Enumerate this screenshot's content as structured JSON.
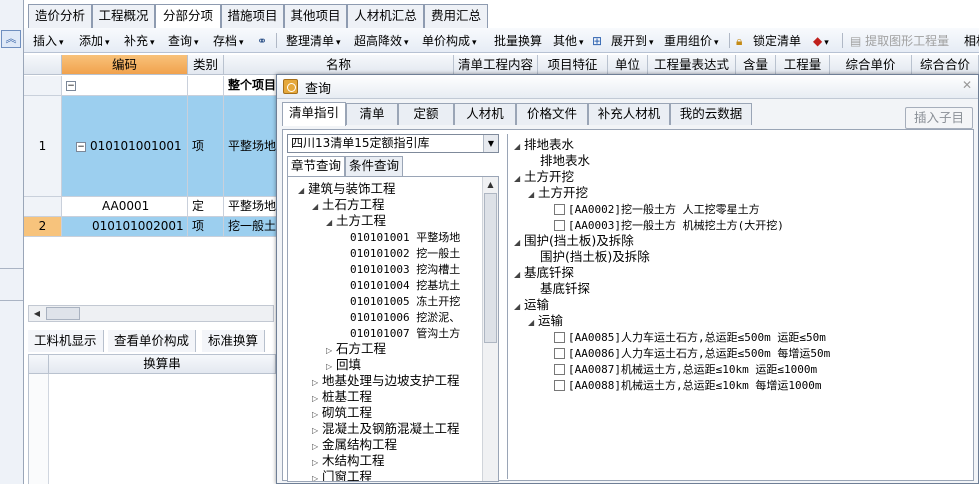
{
  "top_tabs": [
    "造价分析",
    "工程概况",
    "分部分项",
    "措施项目",
    "其他项目",
    "人材机汇总",
    "费用汇总"
  ],
  "active_top_tab": "分部分项",
  "toolbar": {
    "insert": "插入",
    "add": "添加",
    "supplement": "补充",
    "query": "查询",
    "archive": "存档",
    "organize": "整理清单",
    "super_reduce": "超高降效",
    "unit_composition": "单价构成",
    "batch_convert": "批量换算",
    "other": "其他",
    "expand_to": "展开到",
    "reuse_price": "重用组价",
    "lock_list": "锁定清单",
    "extract_quantity": "提取图形工程量",
    "related": "相相"
  },
  "grid": {
    "headers": [
      "编码",
      "类别",
      "名称",
      "清单工程内容",
      "项目特征",
      "单位",
      "工程量表达式",
      "含量",
      "工程量",
      "综合单价",
      "综合合价"
    ],
    "rows": [
      {
        "num": "",
        "code": "",
        "type": "",
        "name": "整个项目"
      },
      {
        "num": "1",
        "code": "010101001001",
        "type": "项",
        "name": "平整场地"
      },
      {
        "num": "",
        "code": "AA0001",
        "type": "定",
        "name": "平整场地"
      },
      {
        "num": "2",
        "code": "010101002001",
        "type": "项",
        "name": "挖一般土"
      }
    ]
  },
  "bottom_tabs": [
    "工料机显示",
    "查看单价构成",
    "标准换算"
  ],
  "bottom_header": "换算串",
  "dialog": {
    "title": "查询",
    "tabs": [
      "清单指引",
      "清单",
      "定额",
      "人材机",
      "价格文件",
      "补充人材机",
      "我的云数据"
    ],
    "active_tab": "清单指引",
    "insert_child": "插入子目",
    "library": "四川13清单15定额指引库",
    "left_tabs": [
      "章节查询",
      "条件查询"
    ],
    "left_tree": [
      {
        "text": "建筑与装饰工程",
        "level": 0,
        "state": "open"
      },
      {
        "text": "土石方工程",
        "level": 1,
        "state": "open"
      },
      {
        "text": "土方工程",
        "level": 2,
        "state": "open"
      },
      {
        "text": "010101001  平整场地",
        "level": 3,
        "state": "leaf"
      },
      {
        "text": "010101002  挖一般土",
        "level": 3,
        "state": "leaf"
      },
      {
        "text": "010101003  挖沟槽土",
        "level": 3,
        "state": "leaf"
      },
      {
        "text": "010101004  挖基坑土",
        "level": 3,
        "state": "leaf"
      },
      {
        "text": "010101005  冻土开挖",
        "level": 3,
        "state": "leaf"
      },
      {
        "text": "010101006  挖淤泥、",
        "level": 3,
        "state": "leaf"
      },
      {
        "text": "010101007  管沟土方",
        "level": 3,
        "state": "leaf"
      },
      {
        "text": "石方工程",
        "level": 2,
        "state": "closed"
      },
      {
        "text": "回填",
        "level": 2,
        "state": "closed"
      },
      {
        "text": "地基处理与边坡支护工程",
        "level": 1,
        "state": "closed"
      },
      {
        "text": "桩基工程",
        "level": 1,
        "state": "closed"
      },
      {
        "text": "砌筑工程",
        "level": 1,
        "state": "closed"
      },
      {
        "text": "混凝土及钢筋混凝土工程",
        "level": 1,
        "state": "closed"
      },
      {
        "text": "金属结构工程",
        "level": 1,
        "state": "closed"
      },
      {
        "text": "木结构工程",
        "level": 1,
        "state": "closed"
      },
      {
        "text": "门窗工程",
        "level": 1,
        "state": "closed"
      }
    ],
    "right_tree": [
      {
        "text": "排地表水",
        "level": 0,
        "state": "open"
      },
      {
        "text": "排地表水",
        "level": 1,
        "state": "leaf"
      },
      {
        "text": "土方开挖",
        "level": 0,
        "state": "open"
      },
      {
        "text": "土方开挖",
        "level": 1,
        "state": "open"
      },
      {
        "text": "[AA0002]挖一般土方 人工挖零星土方",
        "level": 2,
        "state": "check"
      },
      {
        "text": "[AA0003]挖一般土方 机械挖土方(大开挖)",
        "level": 2,
        "state": "check"
      },
      {
        "text": "围护(挡土板)及拆除",
        "level": 0,
        "state": "open"
      },
      {
        "text": "围护(挡土板)及拆除",
        "level": 1,
        "state": "leaf"
      },
      {
        "text": "基底钎探",
        "level": 0,
        "state": "open"
      },
      {
        "text": "基底钎探",
        "level": 1,
        "state": "leaf"
      },
      {
        "text": "运输",
        "level": 0,
        "state": "open"
      },
      {
        "text": "运输",
        "level": 1,
        "state": "open"
      },
      {
        "text": "[AA0085]人力车运土石方,总运距≤500m 运距≤50m",
        "level": 2,
        "state": "check"
      },
      {
        "text": "[AA0086]人力车运土石方,总运距≤500m 每增运50m",
        "level": 2,
        "state": "check"
      },
      {
        "text": "[AA0087]机械运土方,总运距≤10km 运距≤1000m",
        "level": 2,
        "state": "check"
      },
      {
        "text": "[AA0088]机械运土方,总运距≤10km 每增运1000m",
        "level": 2,
        "state": "check"
      }
    ]
  }
}
